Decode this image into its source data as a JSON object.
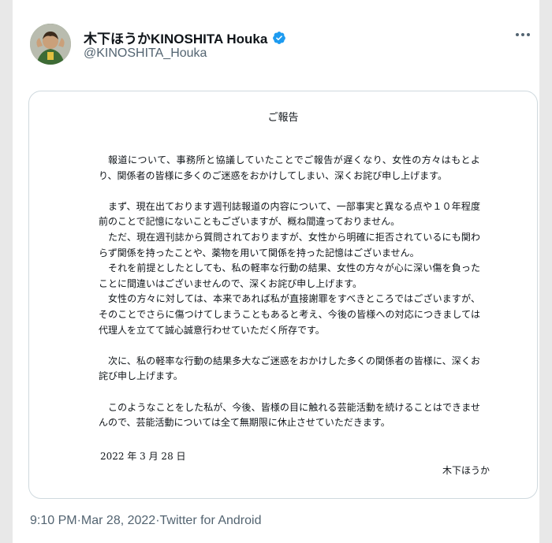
{
  "tweet": {
    "display_name": "木下ほうかKINOSHITA Houka",
    "handle": "@KINOSHITA_Houka",
    "verified_icon": "verified-badge",
    "more_icon": "more-options",
    "colors": {
      "verified": "#1d9bf0",
      "secondary_text": "#536471"
    }
  },
  "document": {
    "title": "ご報告",
    "paragraphs": [
      "報道について、事務所と協議していたことでご報告が遅くなり、女性の方々はもとより、関係者の皆様に多くのご迷惑をおかけしてしまい、深くお詫び申し上げます。",
      "",
      "まず、現在出ております週刊誌報道の内容について、一部事実と異なる点や１０年程度前のことで記憶にないこともございますが、概ね間違っておりません。",
      "ただ、現在週刊誌から質問されておりますが、女性から明確に拒否されているにも関わらず関係を持ったことや、薬物を用いて関係を持った記憶はございません。",
      "それを前提としたとしても、私の軽率な行動の結果、女性の方々が心に深い傷を負ったことに間違いはございませんので、深くお詫び申し上げます。",
      "女性の方々に対しては、本来であれば私が直接謝罪をすべきところではございますが、そのことでさらに傷つけてしまうこともあると考え、今後の皆様への対応につきましては代理人を立てて誠心誠意行わせていただく所存です。",
      "",
      "次に、私の軽率な行動の結果多大なご迷惑をおかけした多くの関係者の皆様に、深くお詫び申し上げます。",
      "",
      "このようなことをした私が、今後、皆様の目に触れる芸能活動を続けることはできませんので、芸能活動については全て無期限に休止させていただきます。"
    ],
    "date": "2022 年 3 月 28 日",
    "signature": "木下ほうか"
  },
  "meta": {
    "time": "9:10 PM",
    "separator": " · ",
    "date": "Mar 28, 2022",
    "source": "Twitter for Android"
  }
}
